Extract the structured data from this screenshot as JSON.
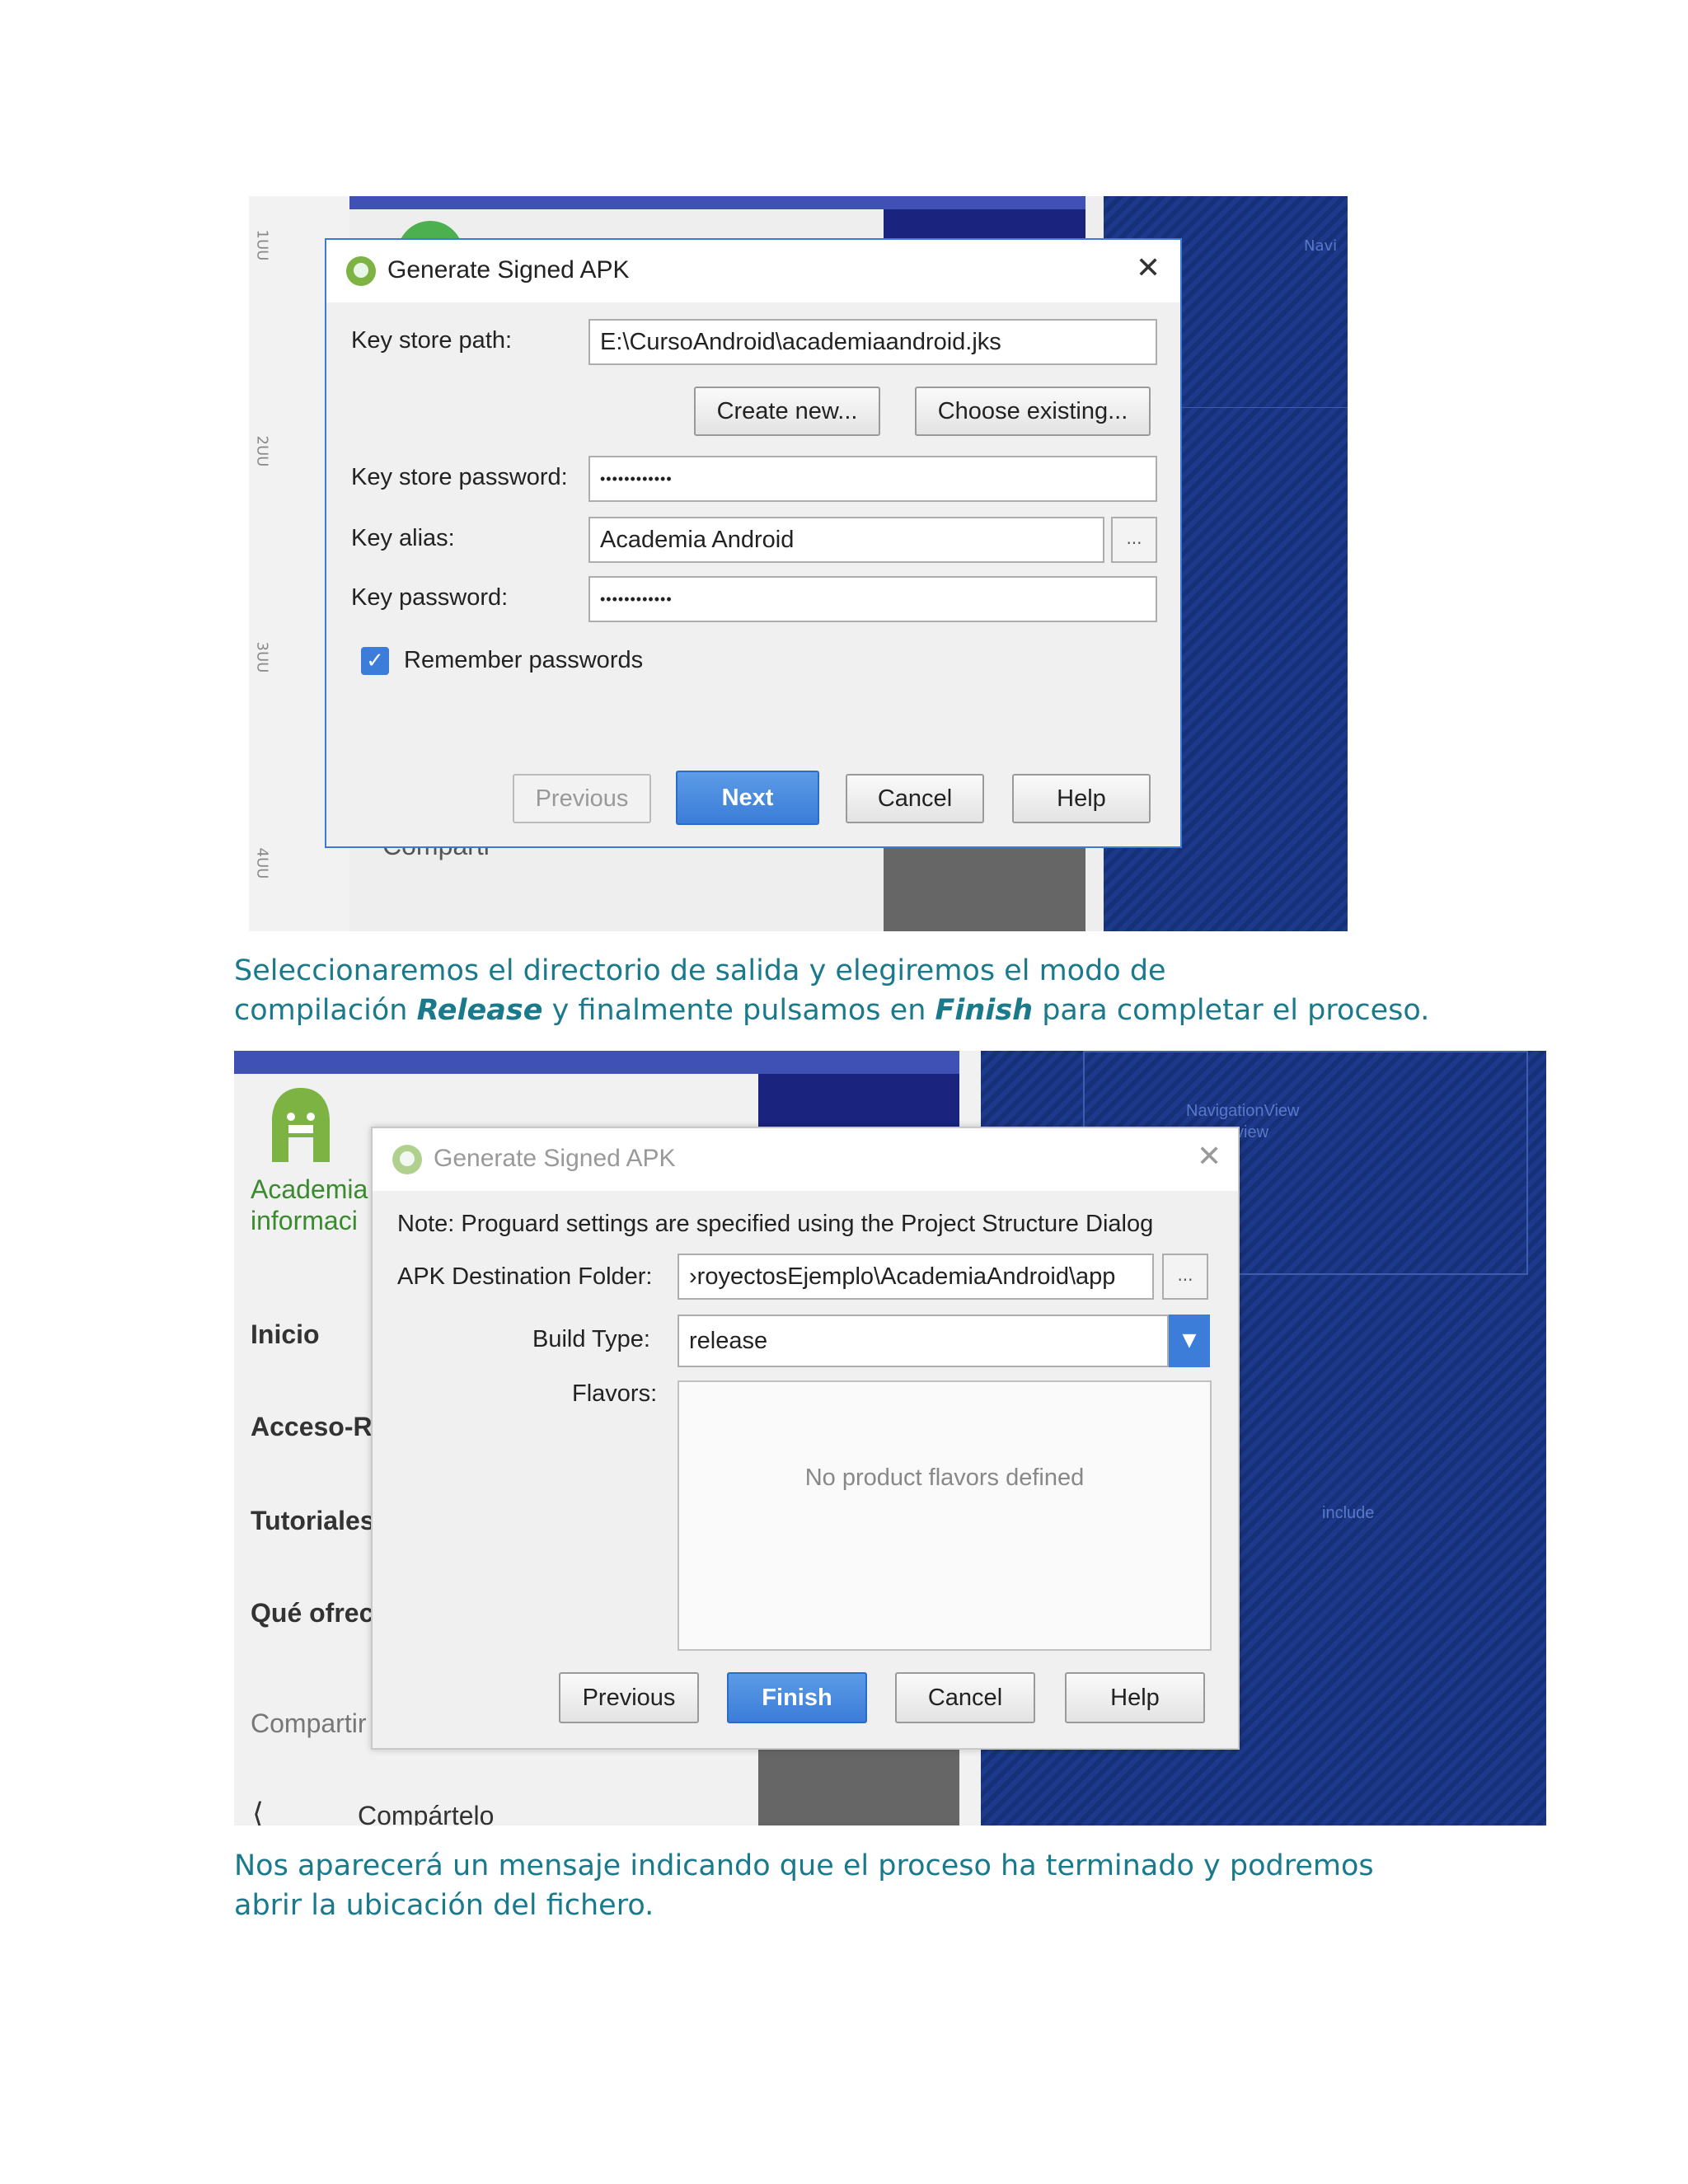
{
  "dialog1": {
    "title": "Generate Signed APK",
    "close": "✕",
    "key_store_path_label": "Key store path:",
    "key_store_path_value": "E:\\CursoAndroid\\academiaandroid.jks",
    "create_new_label": "Create new...",
    "choose_existing_label": "Choose existing...",
    "key_store_password_label": "Key store password:",
    "key_store_password_value": "••••••••••••",
    "key_alias_label": "Key alias:",
    "key_alias_value": "Academia Android",
    "key_alias_browse": "...",
    "key_password_label": "Key password:",
    "key_password_value": "••••••••••••",
    "remember_label": "Remember passwords",
    "remember_checked": true,
    "buttons": {
      "previous": "Previous",
      "next": "Next",
      "cancel": "Cancel",
      "help": "Help"
    }
  },
  "background1": {
    "ruler_marks": [
      "1UU",
      "2UU",
      "3UU",
      "4UU"
    ],
    "partial_text": "Comparti",
    "nav_label": "Navi\nna"
  },
  "paragraph1": {
    "line1": "Seleccionaremos el directorio de salida y elegiremos el modo de",
    "line2_a": "compilación ",
    "line2_b": "Release",
    "line2_c": " y finalmente pulsamos en ",
    "line2_d": "Finish",
    "line2_e": " para completar el proceso."
  },
  "dialog2": {
    "title": "Generate Signed APK",
    "close": "✕",
    "note": "Note: Proguard settings are specified using the Project Structure Dialog",
    "destination_label": "APK Destination Folder:",
    "destination_value": "›royectosEjemplo\\AcademiaAndroid\\app",
    "destination_browse": "...",
    "build_type_label": "Build Type:",
    "build_type_value": "release",
    "flavors_label": "Flavors:",
    "flavors_empty": "No product flavors defined",
    "buttons": {
      "previous": "Previous",
      "finish": "Finish",
      "cancel": "Cancel",
      "help": "Help"
    }
  },
  "background2": {
    "brand_line1": "Academia",
    "brand_line2": "informaci",
    "sidebar": [
      "Inicio",
      "Acceso-R",
      "Tutoriales",
      "Qué ofrec"
    ],
    "share_header": "Compartir",
    "share_item": "Compártelo",
    "nav_label_1": "NavigationView",
    "nav_label_2": "view",
    "include_label": "include"
  },
  "paragraph2": {
    "line1": "Nos aparecerá un mensaje indicando que el proceso ha terminado y podremos",
    "line2": "abrir la ubicación del fichero."
  },
  "colors": {
    "accent": "#3b7dd8",
    "paragraph_text": "#1a7a8c",
    "navy": "#1a237e",
    "indigo": "#3f51b5"
  }
}
